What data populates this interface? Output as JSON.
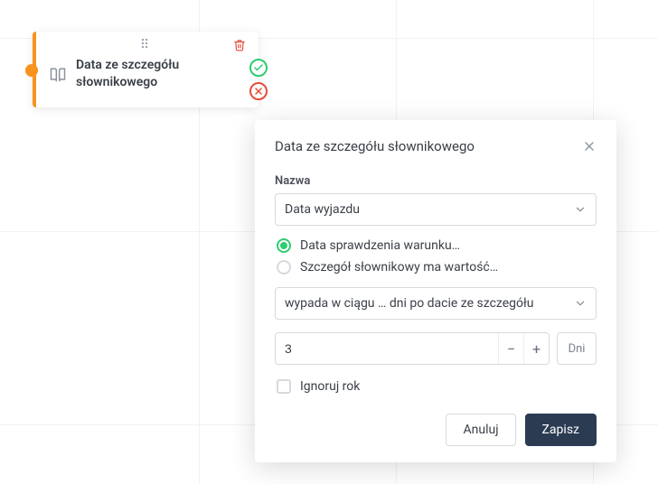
{
  "node": {
    "title": "Data ze szczegółu słownikowego"
  },
  "panel": {
    "title": "Data ze szczegółu słownikowego",
    "name_label": "Nazwa",
    "name_value": "Data wyjazdu",
    "radio_options": [
      {
        "label": "Data sprawdzenia warunku…",
        "checked": true
      },
      {
        "label": "Szczegół słownikowy ma wartość…",
        "checked": false
      }
    ],
    "timing_value": "wypada w ciągu … dni po dacie ze szczegółu",
    "number_value": "3",
    "unit_label": "Dni",
    "ignore_year_label": "Ignoruj rok",
    "cancel_label": "Anuluj",
    "save_label": "Zapisz"
  }
}
